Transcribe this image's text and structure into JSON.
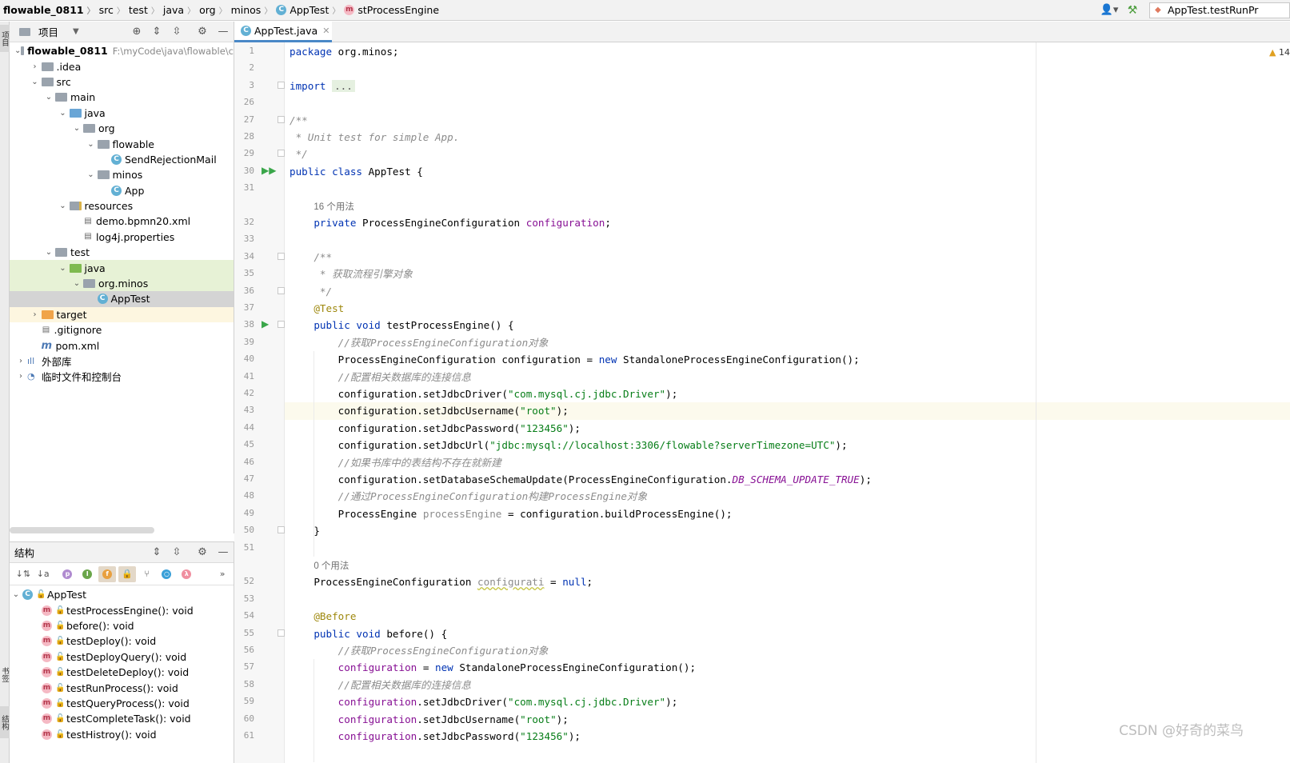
{
  "breadcrumb": [
    {
      "label": "flowable_0811",
      "icon": ""
    },
    {
      "label": "src",
      "icon": ""
    },
    {
      "label": "test",
      "icon": ""
    },
    {
      "label": "java",
      "icon": ""
    },
    {
      "label": "org",
      "icon": ""
    },
    {
      "label": "minos",
      "icon": ""
    },
    {
      "label": "AppTest",
      "icon": "class-icon"
    },
    {
      "label": "stProcessEngine",
      "icon": "method-icon"
    }
  ],
  "run_config": {
    "label": "AppTest.testRunPr"
  },
  "project_panel": {
    "title": "项目",
    "tree": [
      {
        "label": "flowable_0811",
        "path": "F:\\myCode\\java\\flowable\\c",
        "depth": 0,
        "arrow": "v",
        "icon": "folder",
        "bold": true
      },
      {
        "label": ".idea",
        "depth": 1,
        "arrow": ">",
        "icon": "folder"
      },
      {
        "label": "src",
        "depth": 1,
        "arrow": "v",
        "icon": "folder"
      },
      {
        "label": "main",
        "depth": 2,
        "arrow": "v",
        "icon": "folder"
      },
      {
        "label": "java",
        "depth": 3,
        "arrow": "v",
        "icon": "folder-blue"
      },
      {
        "label": "org",
        "depth": 4,
        "arrow": "v",
        "icon": "folder"
      },
      {
        "label": "flowable",
        "depth": 5,
        "arrow": "v",
        "icon": "folder"
      },
      {
        "label": "SendRejectionMail",
        "depth": 6,
        "arrow": "",
        "icon": "class"
      },
      {
        "label": "minos",
        "depth": 5,
        "arrow": "v",
        "icon": "folder"
      },
      {
        "label": "App",
        "depth": 6,
        "arrow": "",
        "icon": "class"
      },
      {
        "label": "resources",
        "depth": 3,
        "arrow": "v",
        "icon": "folder-res"
      },
      {
        "label": "demo.bpmn20.xml",
        "depth": 4,
        "arrow": "",
        "icon": "file"
      },
      {
        "label": "log4j.properties",
        "depth": 4,
        "arrow": "",
        "icon": "file"
      },
      {
        "label": "test",
        "depth": 2,
        "arrow": "v",
        "icon": "folder"
      },
      {
        "label": "java",
        "depth": 3,
        "arrow": "v",
        "icon": "folder-green",
        "state": "hl"
      },
      {
        "label": "org.minos",
        "depth": 4,
        "arrow": "v",
        "icon": "folder",
        "state": "hl"
      },
      {
        "label": "AppTest",
        "depth": 5,
        "arrow": "",
        "icon": "class",
        "state": "sel"
      },
      {
        "label": "target",
        "depth": 1,
        "arrow": ">",
        "icon": "folder-orange",
        "state": "target"
      },
      {
        "label": ".gitignore",
        "depth": 1,
        "arrow": "",
        "icon": "file"
      },
      {
        "label": "pom.xml",
        "depth": 1,
        "arrow": "",
        "icon": "maven"
      },
      {
        "label": "外部库",
        "depth": 0,
        "arrow": ">",
        "icon": "library"
      },
      {
        "label": "临时文件和控制台",
        "depth": 0,
        "arrow": ">",
        "icon": "scratch"
      }
    ]
  },
  "structure_panel": {
    "title": "结构",
    "root": "AppTest",
    "methods": [
      "testProcessEngine(): void",
      "before(): void",
      "testDeploy(): void",
      "testDeployQuery(): void",
      "testDeleteDeploy(): void",
      "testRunProcess(): void",
      "testQueryProcess(): void",
      "testCompleteTask(): void",
      "testHistroy(): void"
    ]
  },
  "editor": {
    "tab_label": "AppTest.java",
    "warning_count": "14",
    "lines": [
      {
        "n": "1",
        "h": "<span class=\"kw\">package</span> org.minos;"
      },
      {
        "n": "2",
        "h": ""
      },
      {
        "n": "3",
        "h": "<span class=\"kw\">import</span> <span class=\"folded\">...</span>",
        "fold": true
      },
      {
        "n": "26",
        "h": ""
      },
      {
        "n": "27",
        "h": "<span class=\"cmt\">/**</span>",
        "fold": true
      },
      {
        "n": "28",
        "h": "<span class=\"cmt\"> * Unit test for simple App.</span>"
      },
      {
        "n": "29",
        "h": "<span class=\"cmt\"> */</span>",
        "fold": true
      },
      {
        "n": "30",
        "h": "<span class=\"kw\">public class</span> AppTest {",
        "run": "▶▶"
      },
      {
        "n": "31",
        "h": ""
      },
      {
        "n": "",
        "h": "    <span class=\"hint\">16 个用法</span>"
      },
      {
        "n": "32",
        "h": "    <span class=\"kw\">private</span> ProcessEngineConfiguration <span class=\"fld\">configuration</span>;"
      },
      {
        "n": "33",
        "h": ""
      },
      {
        "n": "34",
        "h": "    <span class=\"cmt\">/**</span>",
        "fold": true
      },
      {
        "n": "35",
        "h": "<span class=\"cmt\">     * 获取流程引擎对象</span>"
      },
      {
        "n": "36",
        "h": "<span class=\"cmt\">     */</span>",
        "fold": true
      },
      {
        "n": "37",
        "h": "    <span class=\"ann\">@Test</span>"
      },
      {
        "n": "38",
        "h": "    <span class=\"kw\">public void</span> testProcessEngine() {",
        "run": "▶",
        "fold": true
      },
      {
        "n": "39",
        "h": "        <span class=\"cmt\">//获取ProcessEngineConfiguration对象</span>"
      },
      {
        "n": "40",
        "h": "        ProcessEngineConfiguration configuration = <span class=\"kw\">new</span> StandaloneProcessEngineConfiguration();"
      },
      {
        "n": "41",
        "h": "        <span class=\"cmt\">//配置相关数据库的连接信息</span>"
      },
      {
        "n": "42",
        "h": "        configuration.setJdbcDriver(<span class=\"str\">\"com.mysql.cj.jdbc.Driver\"</span>);"
      },
      {
        "n": "43",
        "h": "        configuration.setJdbcUsername(<span class=\"str\">\"root\"</span>);",
        "cur": true
      },
      {
        "n": "44",
        "h": "        configuration.setJdbcPassword(<span class=\"str\">\"123456\"</span>);"
      },
      {
        "n": "45",
        "h": "        configuration.setJdbcUrl(<span class=\"str\">\"jdbc:mysql://localhost:3306/flowable?serverTimezone=UTC\"</span>);"
      },
      {
        "n": "46",
        "h": "        <span class=\"cmt\">//如果书库中的表结构不存在就新建</span>"
      },
      {
        "n": "47",
        "h": "        configuration.setDatabaseSchemaUpdate(ProcessEngineConfiguration.<span class=\"const\">DB_SCHEMA_UPDATE_TRUE</span>);"
      },
      {
        "n": "48",
        "h": "        <span class=\"cmt\">//通过ProcessEngineConfiguration构建ProcessEngine对象</span>"
      },
      {
        "n": "49",
        "h": "        ProcessEngine <span class=\"unused\">processEngine</span> = configuration.buildProcessEngine();"
      },
      {
        "n": "50",
        "h": "    }",
        "fold": true
      },
      {
        "n": "51",
        "h": ""
      },
      {
        "n": "",
        "h": "    <span class=\"hint\">0 个用法</span>"
      },
      {
        "n": "52",
        "h": "    ProcessEngineConfiguration <span class=\"unused warn-word\">configurati</span> = <span class=\"kw\">null</span>;"
      },
      {
        "n": "53",
        "h": ""
      },
      {
        "n": "54",
        "h": "    <span class=\"ann\">@Before</span>"
      },
      {
        "n": "55",
        "h": "    <span class=\"kw\">public void</span> before() {",
        "fold": true
      },
      {
        "n": "56",
        "h": "        <span class=\"cmt\">//获取ProcessEngineConfiguration对象</span>"
      },
      {
        "n": "57",
        "h": "        <span class=\"fld\">configuration</span> = <span class=\"kw\">new</span> StandaloneProcessEngineConfiguration();"
      },
      {
        "n": "58",
        "h": "        <span class=\"cmt\">//配置相关数据库的连接信息</span>"
      },
      {
        "n": "59",
        "h": "        <span class=\"fld\">configuration</span>.setJdbcDriver(<span class=\"str\">\"com.mysql.cj.jdbc.Driver\"</span>);"
      },
      {
        "n": "60",
        "h": "        <span class=\"fld\">configuration</span>.setJdbcUsername(<span class=\"str\">\"root\"</span>);"
      },
      {
        "n": "61",
        "h": "        <span class=\"fld\">configuration</span>.setJdbcPassword(<span class=\"str\">\"123456\"</span>);"
      }
    ]
  },
  "side_tabs": {
    "project": "项目",
    "bookmarks": "书签",
    "structure": "结构"
  },
  "watermark": "CSDN @好奇的菜鸟",
  "colors": {
    "keyword": "#0033b3",
    "string": "#067d17",
    "comment": "#8c8c8c",
    "annotation": "#9e880d",
    "field": "#871094",
    "selection": "#d4d4d4"
  }
}
